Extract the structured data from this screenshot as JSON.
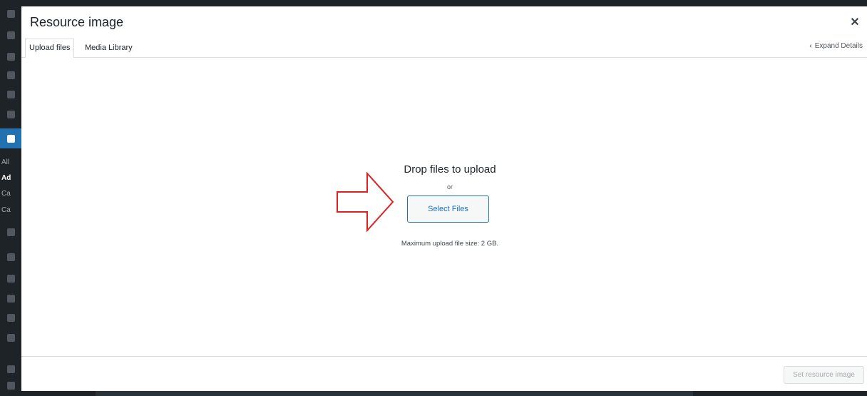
{
  "modal": {
    "title": "Resource image",
    "close_icon": "close-icon"
  },
  "tabs": [
    {
      "label": "Upload files",
      "active": true
    },
    {
      "label": "Media Library",
      "active": false
    }
  ],
  "expand_details": {
    "label": "Expand Details",
    "icon": "chevron-left-icon"
  },
  "uploader": {
    "drop_text": "Drop files to upload",
    "or_text": "or",
    "select_files_label": "Select Files",
    "max_size_text": "Maximum upload file size: 2 GB.",
    "annotation_icon": "red-arrow-icon",
    "annotation_color": "#e02020"
  },
  "toolbar": {
    "set_image_label": "Set resource image",
    "set_image_disabled": true
  },
  "admin_sidebar": {
    "submenu": [
      "All",
      "Ad",
      "Ca",
      "Ca"
    ],
    "accent_color": "#2271b1"
  }
}
